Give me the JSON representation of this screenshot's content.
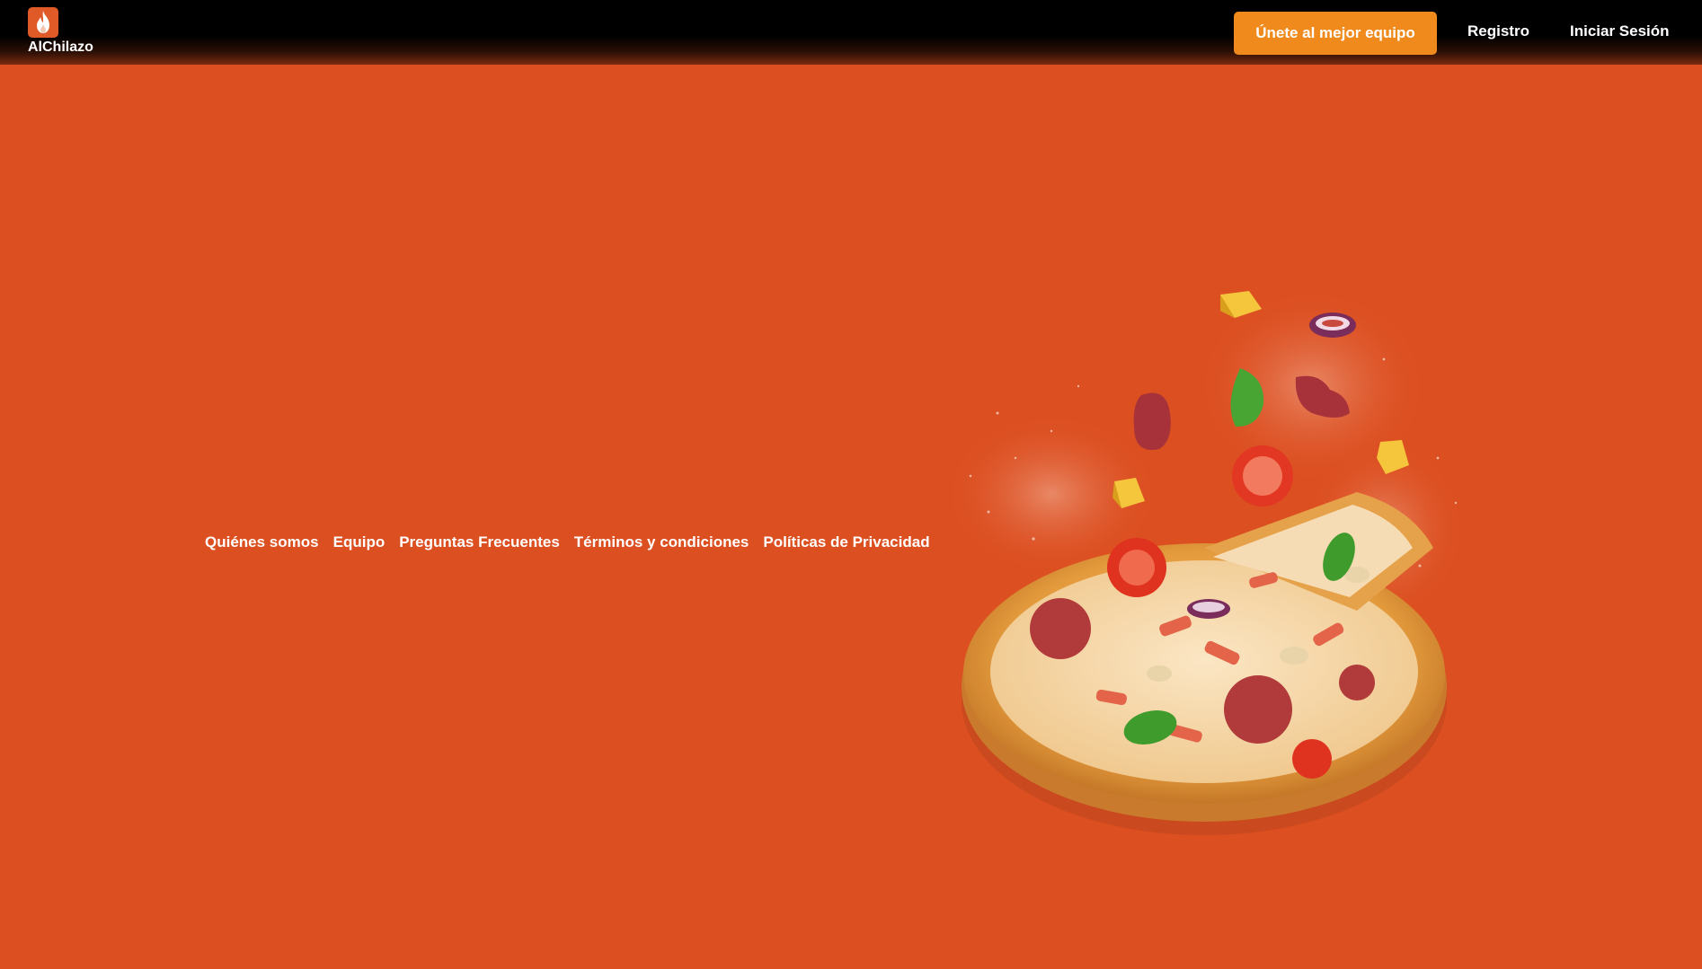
{
  "brand": {
    "name": "AlChilazo",
    "logo_icon": "flame-icon",
    "color": "#e05a28"
  },
  "header": {
    "join_button_label": "Únete al mejor equipo",
    "register_label": "Registro",
    "login_label": "Iniciar Sesión",
    "join_button_color": "#f08a1c"
  },
  "footer": {
    "links": [
      "Quiénes somos",
      "Equipo",
      "Preguntas Frecuentes",
      "Términos y condiciones",
      "Políticas de Privacidad"
    ]
  },
  "theme": {
    "background": "#dc4f21",
    "header_background": "#000000"
  },
  "hero_image": {
    "icon": "pizza-illustration"
  }
}
